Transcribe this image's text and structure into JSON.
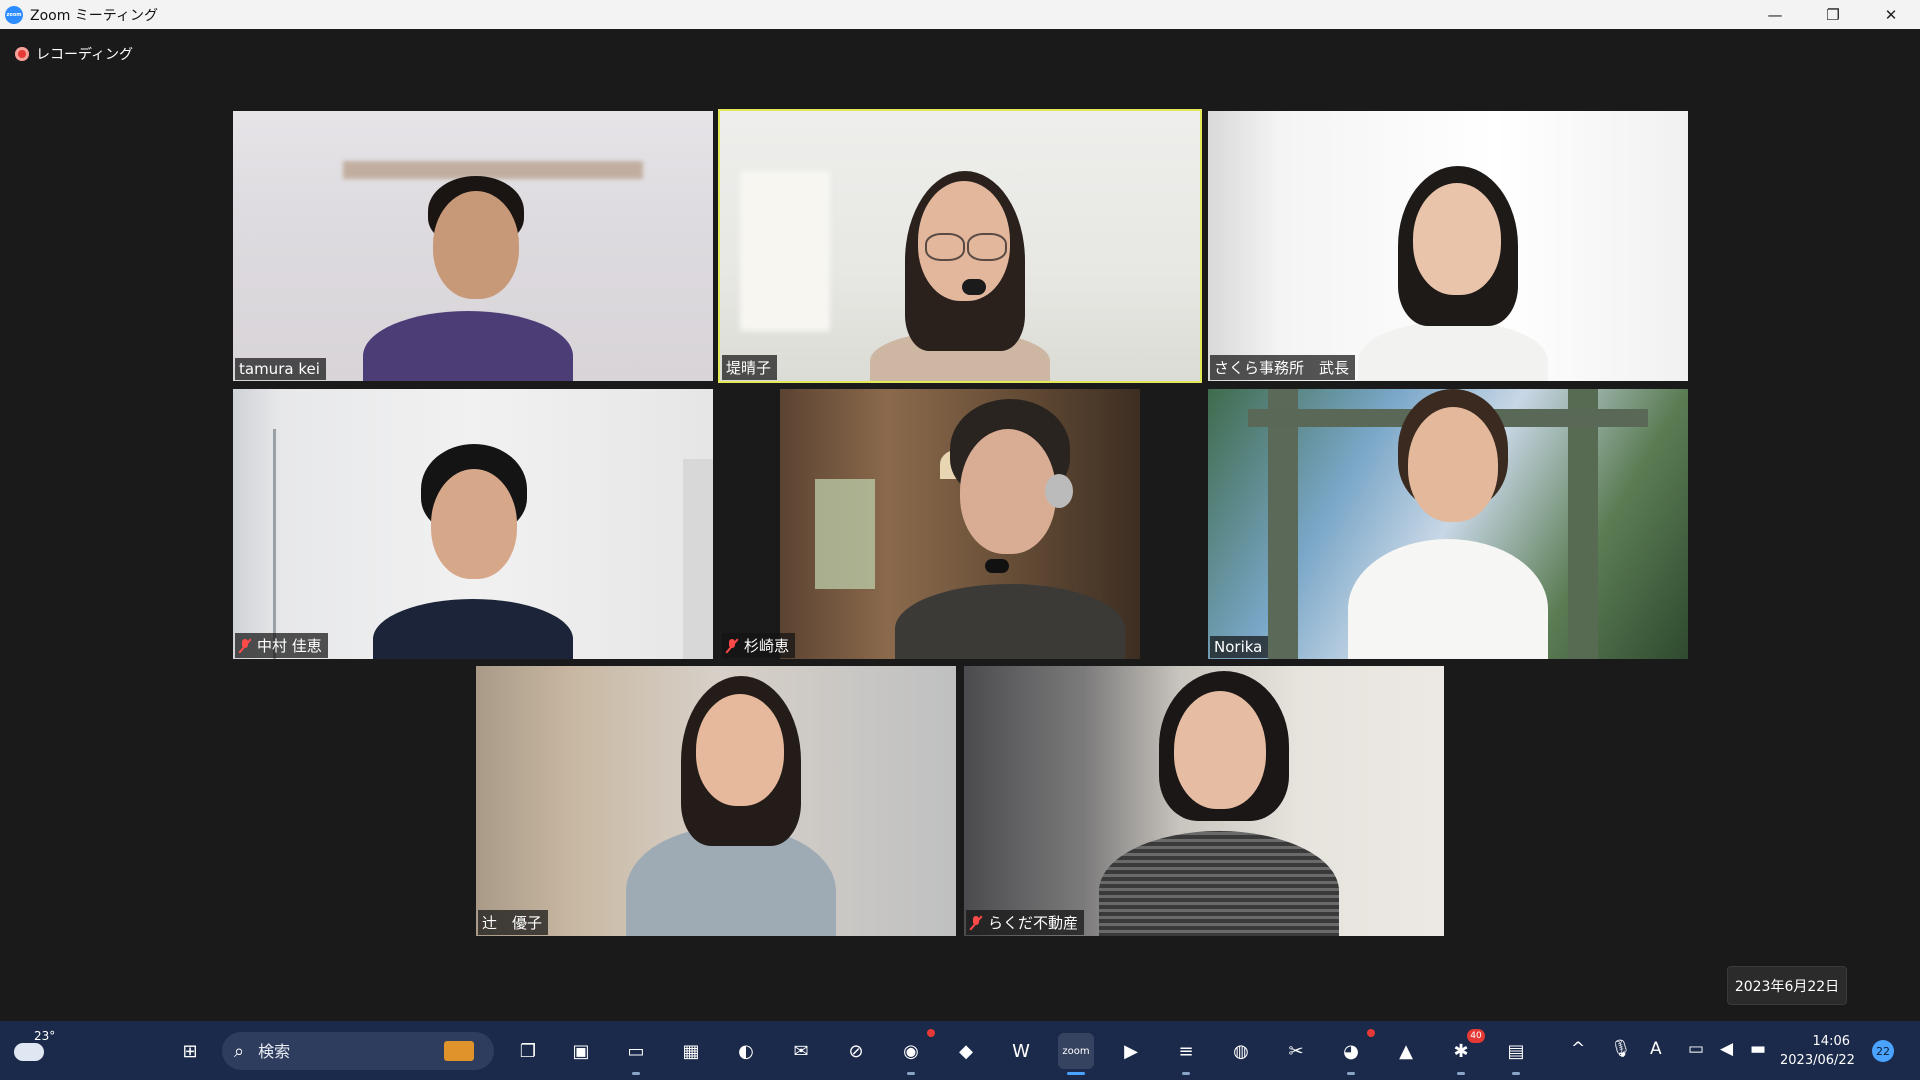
{
  "window": {
    "title": "Zoom ミーティング",
    "logo_text": "zoom",
    "controls": {
      "minimize": "—",
      "restore": "❐",
      "close": "✕"
    }
  },
  "recording": {
    "label": "レコーディング"
  },
  "participants": [
    {
      "name": "tamura kei",
      "muted": false,
      "active_speaker": false
    },
    {
      "name": "堤晴子",
      "muted": false,
      "active_speaker": true
    },
    {
      "name": "さくら事務所　武長",
      "muted": false,
      "active_speaker": false
    },
    {
      "name": "中村 佳恵",
      "muted": true,
      "active_speaker": false
    },
    {
      "name": "杉崎恵",
      "muted": true,
      "active_speaker": false
    },
    {
      "name": "Norika",
      "muted": false,
      "active_speaker": false
    },
    {
      "name": "辻　優子",
      "muted": false,
      "active_speaker": false
    },
    {
      "name": "らくだ不動産",
      "muted": true,
      "active_speaker": false
    }
  ],
  "date_tooltip": "2023年6月22日",
  "taskbar": {
    "weather": {
      "temperature": "23°",
      "icon": "partly-cloudy-icon"
    },
    "search": {
      "placeholder": "検索"
    },
    "apps": [
      {
        "name": "start-button-icon",
        "glyph": "⊞"
      },
      {
        "name": "task-view-icon",
        "glyph": "❐"
      },
      {
        "name": "teams-chat-icon",
        "glyph": "▣"
      },
      {
        "name": "file-explorer-icon",
        "glyph": "▭"
      },
      {
        "name": "microsoft-store-icon",
        "glyph": "▦"
      },
      {
        "name": "edge-icon",
        "glyph": "◐"
      },
      {
        "name": "mail-icon",
        "glyph": "✉"
      },
      {
        "name": "safari-icon",
        "glyph": "⊘"
      },
      {
        "name": "chrome-icon",
        "glyph": "◉"
      },
      {
        "name": "messenger-icon",
        "glyph": "◆"
      },
      {
        "name": "waves-icon",
        "glyph": "W"
      },
      {
        "name": "zoom-icon",
        "glyph": "zoom"
      },
      {
        "name": "copilot-icon",
        "glyph": "▶"
      },
      {
        "name": "notepad-icon",
        "glyph": "≡"
      },
      {
        "name": "globe-icon",
        "glyph": "◍"
      },
      {
        "name": "snipping-tool-icon",
        "glyph": "✂"
      },
      {
        "name": "discord-icon",
        "glyph": "◕"
      },
      {
        "name": "acrobat-icon",
        "glyph": "▲"
      },
      {
        "name": "slack-icon",
        "glyph": "✱"
      },
      {
        "name": "photos-icon",
        "glyph": "▤"
      }
    ],
    "badges": {
      "chrome": "",
      "discord": "",
      "slack": "40"
    },
    "tray": {
      "chevron": "^",
      "mic": "🎙",
      "ime": "A",
      "network": "▭",
      "volume": "◀",
      "battery": "▬"
    },
    "clock": {
      "time": "14:06",
      "date": "2023/06/22"
    },
    "notifications": "22"
  }
}
